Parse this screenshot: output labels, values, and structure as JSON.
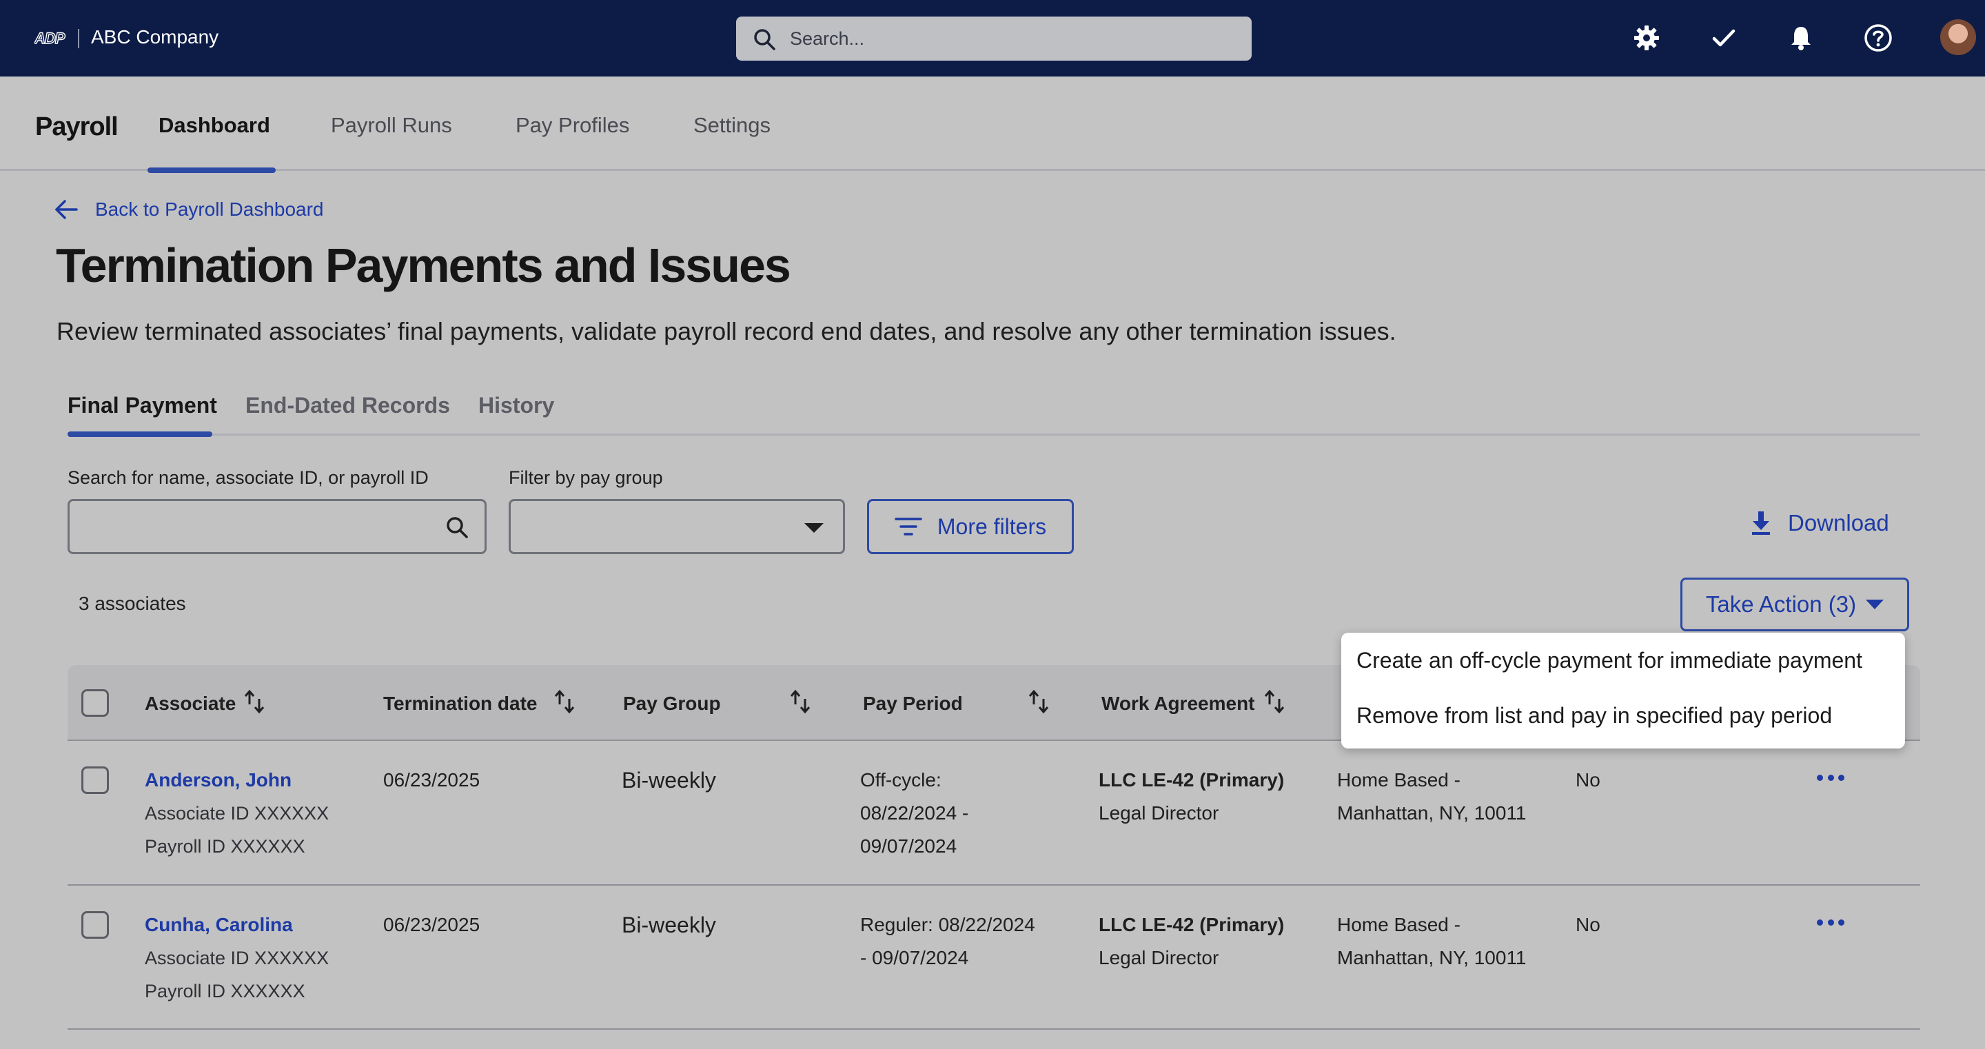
{
  "topbar": {
    "logo_text": "ADP",
    "company": "ABC Company",
    "search_placeholder": "Search...",
    "icons": [
      "gear-icon",
      "check-icon",
      "bell-icon",
      "help-icon",
      "avatar"
    ]
  },
  "product_nav": {
    "title": "Payroll",
    "tabs": [
      {
        "label": "Dashboard",
        "active": true
      },
      {
        "label": "Payroll Runs",
        "active": false
      },
      {
        "label": "Pay Profiles",
        "active": false
      },
      {
        "label": "Settings",
        "active": false
      }
    ]
  },
  "page": {
    "back_label": "Back to Payroll Dashboard",
    "title": "Termination Payments and Issues",
    "description": "Review terminated associates’ final payments, validate payroll record end dates, and resolve any other termination issues."
  },
  "content_tabs": [
    {
      "label": "Final Payment",
      "active": true
    },
    {
      "label": "End-Dated Records",
      "active": false
    },
    {
      "label": "History",
      "active": false
    }
  ],
  "filters": {
    "search_label": "Search for name, associate ID, or payroll ID",
    "search_value": "",
    "paygroup_label": "Filter by pay group",
    "paygroup_value": "",
    "more_filters_label": "More filters",
    "download_label": "Download"
  },
  "summary": {
    "count_text": "3 associates",
    "take_action_label": "Take Action (3)"
  },
  "take_action_menu": [
    "Create an off-cycle payment for immediate payment",
    "Remove from list and pay in specified pay period"
  ],
  "table": {
    "columns": [
      "Associate",
      "Termination date",
      "Pay Group",
      "Pay Period",
      "Work Agreement"
    ],
    "rows": [
      {
        "name": "Anderson, John",
        "associate_id": "Associate ID XXXXXX",
        "payroll_id": "Payroll ID XXXXXX",
        "termination_date": "06/23/2025",
        "pay_group": "Bi-weekly",
        "pay_period_line1": "Off-cycle:",
        "pay_period_line2": "08/22/2024 -",
        "pay_period_line3": "09/07/2024",
        "agreement": "LLC LE-42 (Primary)",
        "agreement_role": "Legal Director",
        "location_line1": "Home Based -",
        "location_line2": "Manhattan, NY, 10011",
        "flag": "No"
      },
      {
        "name": "Cunha, Carolina",
        "associate_id": "Associate ID XXXXXX",
        "payroll_id": "Payroll ID XXXXXX",
        "termination_date": "06/23/2025",
        "pay_group": "Bi-weekly",
        "pay_period_line1": "Reguler: 08/22/2024",
        "pay_period_line2": "- 09/07/2024",
        "pay_period_line3": "",
        "agreement": "LLC LE-42 (Primary)",
        "agreement_role": "Legal Director",
        "location_line1": "Home Based -",
        "location_line2": "Manhattan, NY, 10011",
        "flag": "No"
      }
    ]
  },
  "colors": {
    "topbar_bg": "#0d1c47",
    "accent": "#2d4aa4",
    "link": "#1d3aa5",
    "overlay_bg": "#c2c2c2"
  }
}
